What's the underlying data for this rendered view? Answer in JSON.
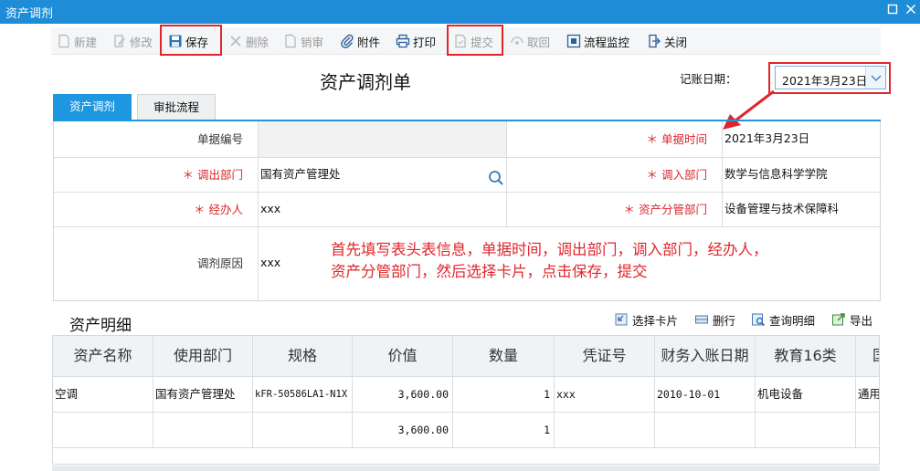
{
  "window": {
    "title": "资产调剂"
  },
  "toolbar": {
    "new": "新建",
    "edit": "修改",
    "save": "保存",
    "delete": "删除",
    "cancel_audit": "销审",
    "attach": "附件",
    "print": "打印",
    "submit": "提交",
    "withdraw": "取回",
    "monitor": "流程监控",
    "close": "关闭"
  },
  "form": {
    "title": "资产调剂单",
    "date_label": "记账日期：",
    "date_value": "2021年3月23日",
    "required_mark": "＊",
    "tabs": [
      "资产调剂",
      "审批流程"
    ],
    "fields": {
      "doc_no_label": "单据编号",
      "doc_no_value": "",
      "doc_time_label": "单据时间",
      "doc_time_value": "2021年3月23日",
      "out_dept_label": "调出部门",
      "out_dept_value": "国有资产管理处",
      "in_dept_label": "调入部门",
      "in_dept_value": "数学与信息科学学院",
      "handler_label": "经办人",
      "handler_value": "xxx",
      "mgmt_dept_label": "资产分管部门",
      "mgmt_dept_value": "设备管理与技术保障科",
      "reason_label": "调剂原因",
      "reason_value": "xxx"
    },
    "annotation": {
      "line1": "首先填写表头表信息，单据时间，调出部门，调入部门，经办人，",
      "line2": "资产分管部门，然后选择卡片，点击保存，提交"
    }
  },
  "details": {
    "title": "资产明细",
    "actions": {
      "select_card": "选择卡片",
      "delete_row": "删行",
      "query": "查询明细",
      "export": "导出"
    },
    "columns": [
      "资产名称",
      "使用部门",
      "规格",
      "价值",
      "数量",
      "凭证号",
      "财务入账日期",
      "教育16类",
      "国"
    ],
    "rows": [
      {
        "name": "空调",
        "dept": "国有资产管理处",
        "spec": "kFR-50586LA1-N1X",
        "value": "3,600.00",
        "qty": "1",
        "voucher": "xxx",
        "date": "2010-10-01",
        "cat": "机电设备",
        "extra": "通用"
      }
    ],
    "total": {
      "value": "3,600.00",
      "qty": "1"
    }
  },
  "colors": {
    "titlebar": "#1e8cd6",
    "accent": "#1e96e0",
    "highlight": "#e0262c"
  }
}
